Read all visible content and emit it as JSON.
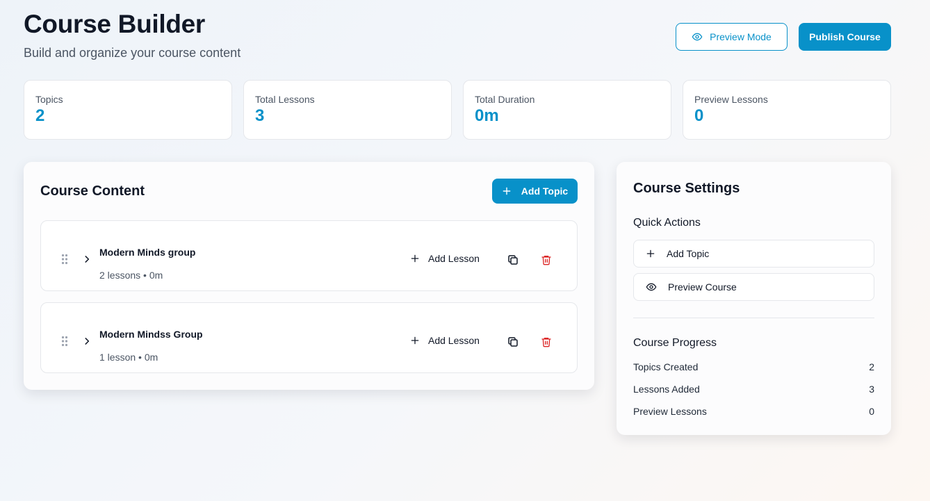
{
  "header": {
    "title": "Course Builder",
    "subtitle": "Build and organize your course content",
    "preview_mode_label": "Preview Mode",
    "publish_label": "Publish Course"
  },
  "stats": [
    {
      "label": "Topics",
      "value": "2"
    },
    {
      "label": "Total Lessons",
      "value": "3"
    },
    {
      "label": "Total Duration",
      "value": "0m"
    },
    {
      "label": "Preview Lessons",
      "value": "0"
    }
  ],
  "content": {
    "title": "Course Content",
    "add_topic_label": "Add Topic",
    "topics": [
      {
        "name": "Modern Minds group",
        "meta": "2 lessons • 0m",
        "add_lesson_label": "Add Lesson"
      },
      {
        "name": "Modern Mindss Group",
        "meta": "1 lesson • 0m",
        "add_lesson_label": "Add Lesson"
      }
    ]
  },
  "settings": {
    "title": "Course Settings",
    "quick_actions_title": "Quick Actions",
    "add_topic_label": "Add Topic",
    "preview_course_label": "Preview Course",
    "progress_title": "Course Progress",
    "progress": [
      {
        "label": "Topics Created",
        "value": "2"
      },
      {
        "label": "Lessons Added",
        "value": "3"
      },
      {
        "label": "Preview Lessons",
        "value": "0"
      }
    ]
  },
  "colors": {
    "accent": "#0891c9",
    "danger": "#dc2626",
    "text": "#111827",
    "muted": "#4b5563"
  },
  "icons": [
    "eye-icon",
    "plus-icon",
    "drag-handle-icon",
    "chevron-right-icon",
    "copy-icon",
    "trash-icon"
  ]
}
